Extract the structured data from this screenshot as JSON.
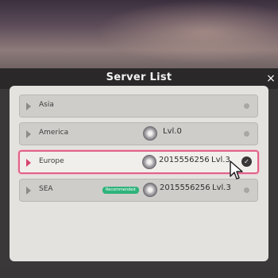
{
  "dialog": {
    "title": "Server List",
    "close_label": "×"
  },
  "servers": [
    {
      "name": "Asia",
      "uid": "",
      "level": "",
      "selected": false,
      "badge": ""
    },
    {
      "name": "America",
      "uid": "",
      "level": "Lvl.0",
      "selected": false,
      "badge": ""
    },
    {
      "name": "Europe",
      "uid": "2015556256",
      "level": "Lvl.3",
      "selected": true,
      "badge": ""
    },
    {
      "name": "SEA",
      "uid": "2015556256",
      "level": "Lvl.3",
      "selected": false,
      "badge": "Recommended"
    }
  ],
  "icons": {
    "chevron": "chevron-right-icon",
    "avatar": "avatar-icon",
    "check": "check-icon",
    "status": "status-dot-icon",
    "cursor": "mouse-pointer-icon"
  },
  "colors": {
    "selected_border": "#e0628a",
    "badge": "#2fb37a"
  }
}
